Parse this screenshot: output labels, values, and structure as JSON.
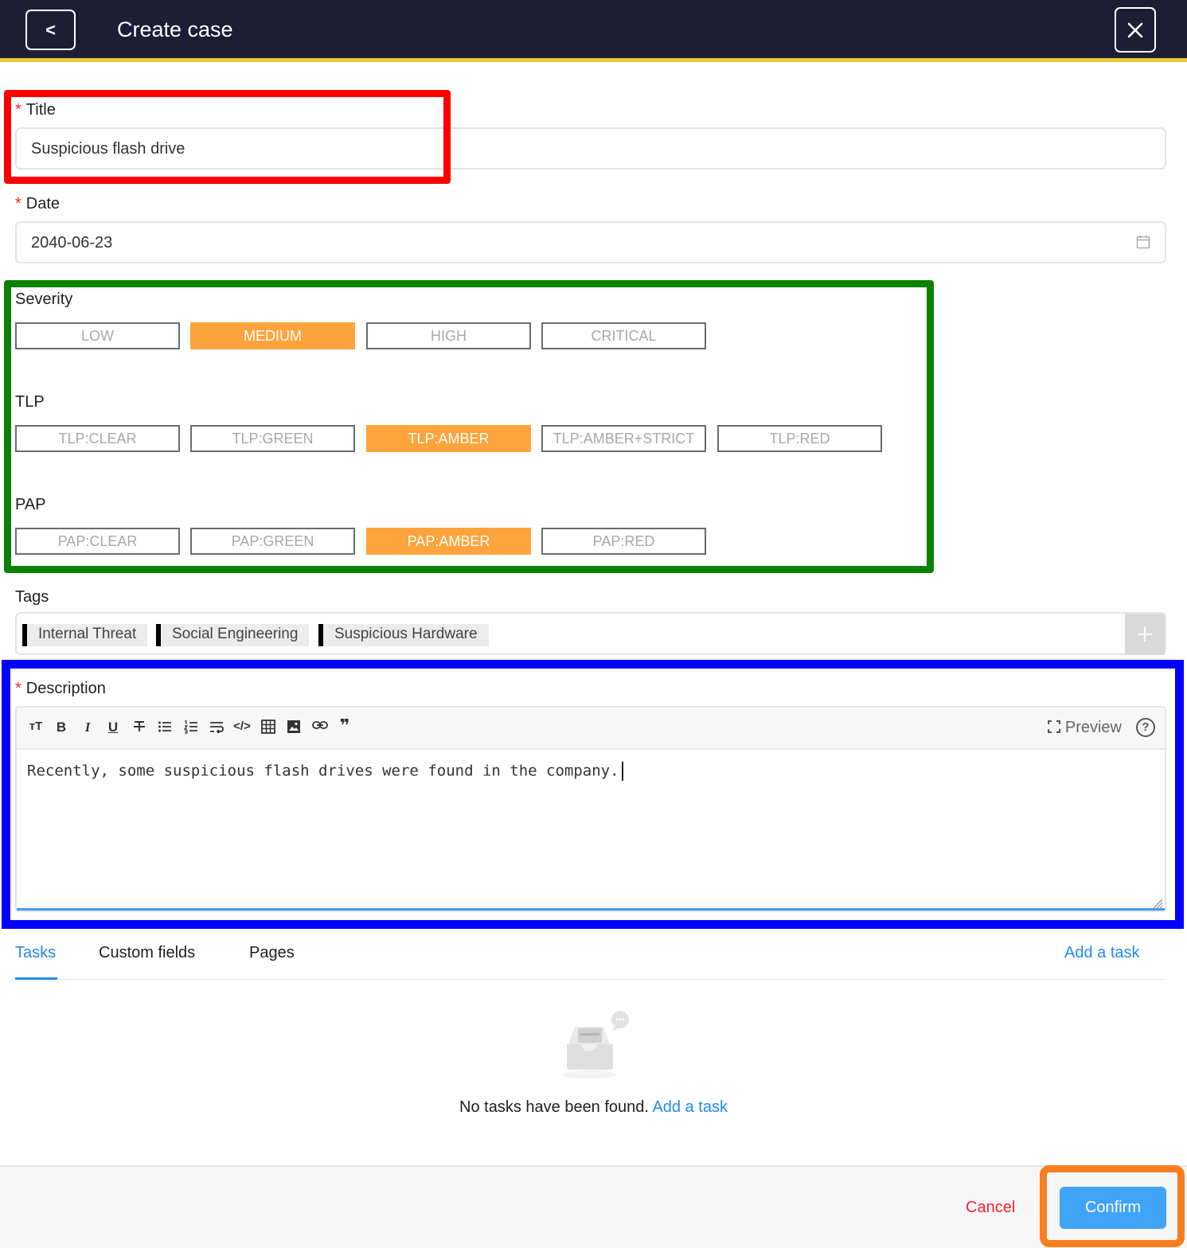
{
  "header": {
    "back_label": "<",
    "title": "Create case"
  },
  "form": {
    "title": {
      "label": "Title",
      "value": "Suspicious flash drive"
    },
    "date": {
      "label": "Date",
      "value": "2040-06-23"
    },
    "severity": {
      "label": "Severity",
      "options": [
        "LOW",
        "MEDIUM",
        "HIGH",
        "CRITICAL"
      ],
      "selected": "MEDIUM"
    },
    "tlp": {
      "label": "TLP",
      "options": [
        "TLP:CLEAR",
        "TLP:GREEN",
        "TLP:AMBER",
        "TLP:AMBER+STRICT",
        "TLP:RED"
      ],
      "selected": "TLP:AMBER"
    },
    "pap": {
      "label": "PAP",
      "options": [
        "PAP:CLEAR",
        "PAP:GREEN",
        "PAP:AMBER",
        "PAP:RED"
      ],
      "selected": "PAP:AMBER"
    },
    "tags": {
      "label": "Tags",
      "items": [
        "Internal Threat",
        "Social Engineering",
        "Suspicious Hardware"
      ]
    },
    "description": {
      "label": "Description",
      "preview_label": "Preview",
      "help_label": "?",
      "text": "Recently, some suspicious flash drives were found in the company."
    }
  },
  "tabs": {
    "items": [
      "Tasks",
      "Custom fields",
      "Pages"
    ],
    "active": "Tasks",
    "add_task_label": "Add a task"
  },
  "empty_state": {
    "message": "No tasks have been found.",
    "link": "Add a task"
  },
  "footer": {
    "cancel_label": "Cancel",
    "confirm_label": "Confirm"
  },
  "colors": {
    "header_bg": "#1d1e35",
    "header_accent": "#e8c93a",
    "selected_option": "#ffa43c",
    "link": "#1e8bf0",
    "required": "#f5222d",
    "confirm_bg": "#3fa3f6",
    "annotation_red": "#ff0000",
    "annotation_green": "#0a8100",
    "annotation_blue": "#0000ff",
    "annotation_orange": "#fa7d1e"
  }
}
